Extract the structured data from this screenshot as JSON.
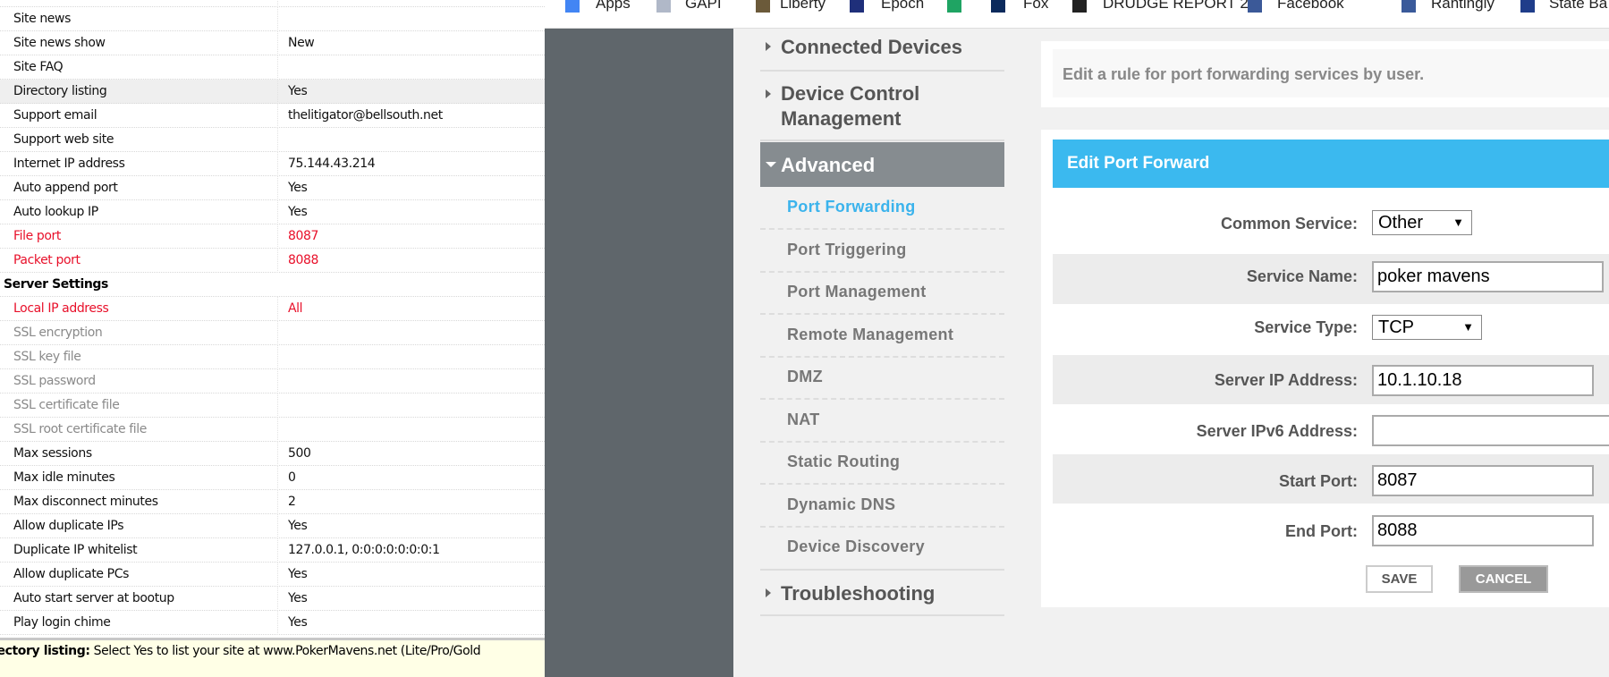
{
  "settings_table": {
    "rows": [
      {
        "label": "Site news",
        "value": "",
        "style": "normal"
      },
      {
        "label": "Site news show",
        "value": "New",
        "style": "normal"
      },
      {
        "label": "Site FAQ",
        "value": "",
        "style": "normal"
      },
      {
        "label": "Directory listing",
        "value": "Yes",
        "style": "selected"
      },
      {
        "label": "Support email",
        "value": "thelitigator@bellsouth.net",
        "style": "normal"
      },
      {
        "label": "Support web site",
        "value": "",
        "style": "normal"
      },
      {
        "label": "Internet IP address",
        "value": "75.144.43.214",
        "style": "normal"
      },
      {
        "label": "Auto append port",
        "value": "Yes",
        "style": "normal"
      },
      {
        "label": "Auto lookup IP",
        "value": "Yes",
        "style": "normal"
      },
      {
        "label": "File port",
        "value": "8087",
        "style": "red"
      },
      {
        "label": "Packet port",
        "value": "8088",
        "style": "red"
      },
      {
        "label": "Server Settings",
        "value": "",
        "style": "header"
      },
      {
        "label": "Local IP address",
        "value": "All",
        "style": "red"
      },
      {
        "label": "SSL encryption",
        "value": "",
        "style": "disabled"
      },
      {
        "label": "SSL key file",
        "value": "",
        "style": "disabled"
      },
      {
        "label": "SSL password",
        "value": "",
        "style": "disabled"
      },
      {
        "label": "SSL certificate file",
        "value": "",
        "style": "disabled"
      },
      {
        "label": "SSL root certificate file",
        "value": "",
        "style": "disabled"
      },
      {
        "label": "Max sessions",
        "value": "500",
        "style": "normal"
      },
      {
        "label": "Max idle minutes",
        "value": "0",
        "style": "normal"
      },
      {
        "label": "Max disconnect minutes",
        "value": "2",
        "style": "normal"
      },
      {
        "label": "Allow duplicate IPs",
        "value": "Yes",
        "style": "normal"
      },
      {
        "label": "Duplicate IP whitelist",
        "value": "127.0.0.1, 0:0:0:0:0:0:0:1",
        "style": "normal"
      },
      {
        "label": "Allow duplicate PCs",
        "value": "Yes",
        "style": "normal"
      },
      {
        "label": "Auto start server at bootup",
        "value": "Yes",
        "style": "normal"
      },
      {
        "label": "Play login chime",
        "value": "Yes",
        "style": "normal"
      }
    ],
    "status_label": "rectory listing:",
    "status_text": "Select Yes to list your site at www.PokerMavens.net (Lite/Pro/Gold"
  },
  "bookmarks": [
    {
      "label": "Apps",
      "icon": "apps-grid-icon",
      "color": "#4285f4"
    },
    {
      "label": "GAPI",
      "icon": "envelope-icon",
      "color": "#b0b8c8"
    },
    {
      "label": "Liberty",
      "icon": "statue-icon",
      "color": "#6b5a3a"
    },
    {
      "label": "Epoch",
      "icon": "et-logo-icon",
      "color": "#1f2f7a"
    },
    {
      "label": "",
      "icon": "google-drive-icon",
      "color": "#1fa463"
    },
    {
      "label": "Fox",
      "icon": "fox-logo-icon",
      "color": "#0b2a5c"
    },
    {
      "label": "DRUDGE REPORT 2...",
      "icon": "drudge-logo-icon",
      "color": "#222222"
    },
    {
      "label": "Facebook",
      "icon": "facebook-icon",
      "color": "#3b5998"
    },
    {
      "label": "Rantingly",
      "icon": "globe-icon",
      "color": "#3a5a9a"
    },
    {
      "label": "State Ba",
      "icon": "state-seal-icon",
      "color": "#1f3d8a"
    }
  ],
  "sidebar": {
    "sections": [
      "Connected Devices",
      "Device Control",
      "Management",
      "Advanced",
      "Troubleshooting"
    ],
    "advanced_items": [
      "Port Forwarding",
      "Port Triggering",
      "Port Management",
      "Remote Management",
      "DMZ",
      "NAT",
      "Static Routing",
      "Dynamic DNS",
      "Device Discovery"
    ],
    "active_item": "Port Forwarding"
  },
  "info": {
    "text": "Edit a rule for port forwarding services by user."
  },
  "form": {
    "title": "Edit Port Forward",
    "common_service_label": "Common Service:",
    "common_service_value": "Other",
    "service_name_label": "Service Name:",
    "service_name_value": "poker mavens",
    "service_type_label": "Service Type:",
    "service_type_value": "TCP",
    "server_ip_label": "Server IP Address:",
    "server_ip_value": "10.1.10.18",
    "server_ipv6_label": "Server IPv6 Address:",
    "server_ipv6_value": "",
    "start_port_label": "Start Port:",
    "start_port_value": "8087",
    "end_port_label": "End Port:",
    "end_port_value": "8088",
    "save_label": "SAVE",
    "cancel_label": "CANCEL",
    "dropdown_glyph": "▼"
  },
  "colors": {
    "accent": "#3bb9ef",
    "active_link": "#3bb3ec",
    "advanced_bg": "#868c90",
    "error_red": "#e8102a"
  }
}
